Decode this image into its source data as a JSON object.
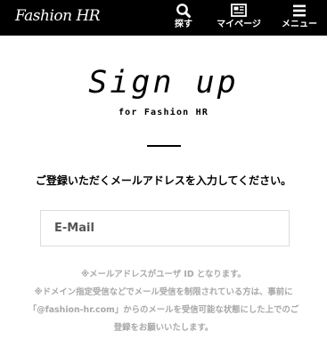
{
  "header": {
    "logo": "Fashion HR",
    "nav": [
      {
        "icon": "search-icon",
        "label": "探す"
      },
      {
        "icon": "newspaper-icon",
        "label": "マイページ"
      },
      {
        "icon": "hamburger-icon",
        "label": "メニュー"
      }
    ]
  },
  "main": {
    "title": "Sign up",
    "subtitle": "for Fashion HR",
    "instruction": "ご登録いただくメールアドレスを入力してください。",
    "email_placeholder": "E-Mail",
    "notes": [
      "※メールアドレスがユーザ ID となります。",
      "※ドメイン指定受信などでメール受信を制限されている方は、事前に",
      "「@fashion-hr.com」からのメールを受信可能な状態にした上でのご",
      "登録をお願いいたします。"
    ]
  }
}
